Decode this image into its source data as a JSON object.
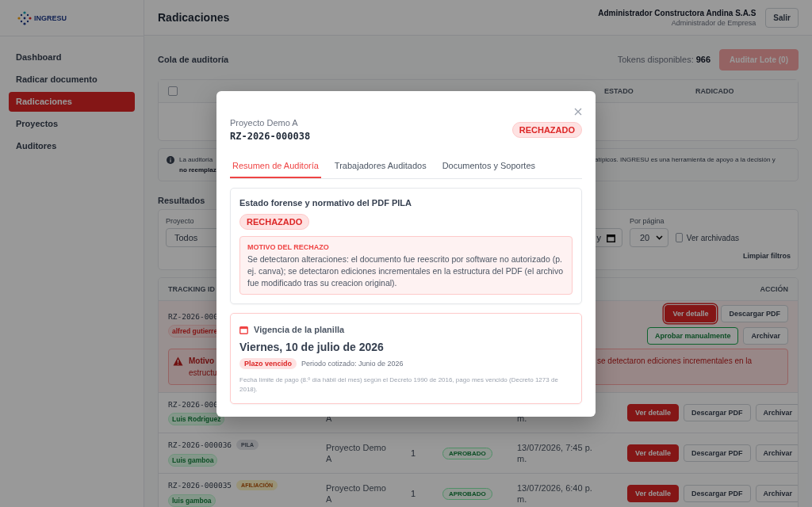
{
  "sidebar": {
    "logo": "INGRESU",
    "items": [
      {
        "label": "Dashboard",
        "selected": false
      },
      {
        "label": "Radicar documento",
        "selected": false
      },
      {
        "label": "Radicaciones",
        "selected": true
      },
      {
        "label": "Proyectos",
        "selected": false
      },
      {
        "label": "Auditores",
        "selected": false
      }
    ]
  },
  "header": {
    "title": "Radicaciones",
    "user_name": "Administrador Constructora Andina S.A.S",
    "user_role": "Administrador de Empresa",
    "logout": "Salir"
  },
  "queue": {
    "title": "Cola de auditoría",
    "tokens_label": "Tokens disponibles:",
    "tokens_value": "966",
    "batch_button": {
      "label": "Auditar Lote (0)",
      "disabled": true
    },
    "select_all": {
      "checked": false
    },
    "columns": [
      "ESTADO",
      "RADICADO"
    ]
  },
  "notice": {
    "left": "La auditoría",
    "left_bold": "no reemplaz",
    "right": "atípicos. INGRESU es una herramienta de apoyo a la decisión y"
  },
  "results": {
    "title": "Resultados",
    "filters": {
      "project_label": "Proyecto",
      "project_value": "Todos",
      "date_value": "y",
      "per_page_label": "Por página",
      "per_page_value": "20",
      "archived": {
        "label": "Ver archivadas",
        "checked": false
      },
      "clear": "Limpiar filtros"
    },
    "columns": [
      "TRACKING ID",
      "ACCIÓN"
    ],
    "rows": [
      {
        "tracking": "RZ-2026-000",
        "worker": {
          "label": "alfred gutierre",
          "kind": "rejected"
        },
        "expanded": true,
        "actions": [
          [
            {
              "label": "Ver detalle",
              "kind": "primary",
              "focused": true
            },
            {
              "label": "Descargar PDF",
              "kind": "secondary",
              "focused": false
            }
          ],
          [
            {
              "label": "Aprobar manualmente",
              "kind": "success",
              "focused": false
            },
            {
              "label": "Archivar",
              "kind": "secondary",
              "focused": false
            }
          ]
        ],
        "alert": {
          "title": "Motivo",
          "left": "estructu",
          "right": "se detectaron ediciones incrementales en la"
        }
      },
      {
        "tracking": "RZ-2026-000",
        "worker": {
          "label": "Luis Rodriguez",
          "kind": "approved"
        },
        "expanded": false,
        "project": "A",
        "date": "m.",
        "actions": [
          [
            {
              "label": "Ver detalle",
              "kind": "primary",
              "focused": false
            },
            {
              "label": "Descargar PDF",
              "kind": "secondary",
              "focused": false
            },
            {
              "label": "Archivar",
              "kind": "secondary",
              "focused": false
            }
          ]
        ]
      },
      {
        "tracking": "RZ-2026-000036",
        "doc": {
          "label": "PILA",
          "kind": "pila"
        },
        "worker": {
          "label": "Luis gamboa",
          "kind": "approved"
        },
        "expanded": false,
        "project": "Proyecto Demo A",
        "workers": "1",
        "status": {
          "label": "APROBADO",
          "kind": "approved"
        },
        "date": "13/07/2026, 7:45 p. m.",
        "actions": [
          [
            {
              "label": "Ver detalle",
              "kind": "primary",
              "focused": false
            },
            {
              "label": "Descargar PDF",
              "kind": "secondary",
              "focused": false
            },
            {
              "label": "Archivar",
              "kind": "secondary",
              "focused": false
            }
          ]
        ]
      },
      {
        "tracking": "RZ-2026-000035",
        "doc": {
          "label": "AFILIACIÓN",
          "kind": "afiliacion"
        },
        "worker": {
          "label": "luis gamboa",
          "kind": "approved"
        },
        "expanded": false,
        "project": "Proyecto Demo A",
        "workers": "1",
        "status": {
          "label": "APROBADO",
          "kind": "approved"
        },
        "date": "13/07/2026, 6:40 p. m.",
        "actions": [
          [
            {
              "label": "Ver detalle",
              "kind": "primary",
              "focused": false
            },
            {
              "label": "Descargar PDF",
              "kind": "secondary",
              "focused": false
            },
            {
              "label": "Archivar",
              "kind": "secondary",
              "focused": false
            }
          ]
        ]
      }
    ]
  },
  "modal": {
    "project": "Proyecto Demo A",
    "tracking": "RZ-2026-000038",
    "status": {
      "label": "RECHAZADO",
      "kind": "rejected"
    },
    "tabs": [
      {
        "label": "Resumen de Auditoría",
        "selected": true
      },
      {
        "label": "Trabajadores Auditados",
        "selected": false
      },
      {
        "label": "Documentos y Soportes",
        "selected": false
      }
    ],
    "forensic": {
      "title": "Estado forense y normativo del PDF PILA",
      "status": {
        "label": "RECHAZADO",
        "kind": "rejected"
      },
      "reason_title": "MOTIVO DEL RECHAZO",
      "reason": "Se detectaron alteraciones: el documento fue reescrito por software no autorizado (p. ej. canva); se detectaron ediciones incrementales en la estructura del PDF (el archivo fue modificado tras su creacion original)."
    },
    "validity": {
      "title": "Vigencia de la planilla",
      "date": "Viernes, 10 de julio de 2026",
      "badge": {
        "label": "Plazo vencido",
        "kind": "expired"
      },
      "period": "Periodo cotizado: Junio de 2026",
      "note": "Fecha límite de pago (8.º día hábil del mes) según el Decreto 1990 de 2016, pago mes vencido (Decreto 1273 de 2018)."
    }
  }
}
